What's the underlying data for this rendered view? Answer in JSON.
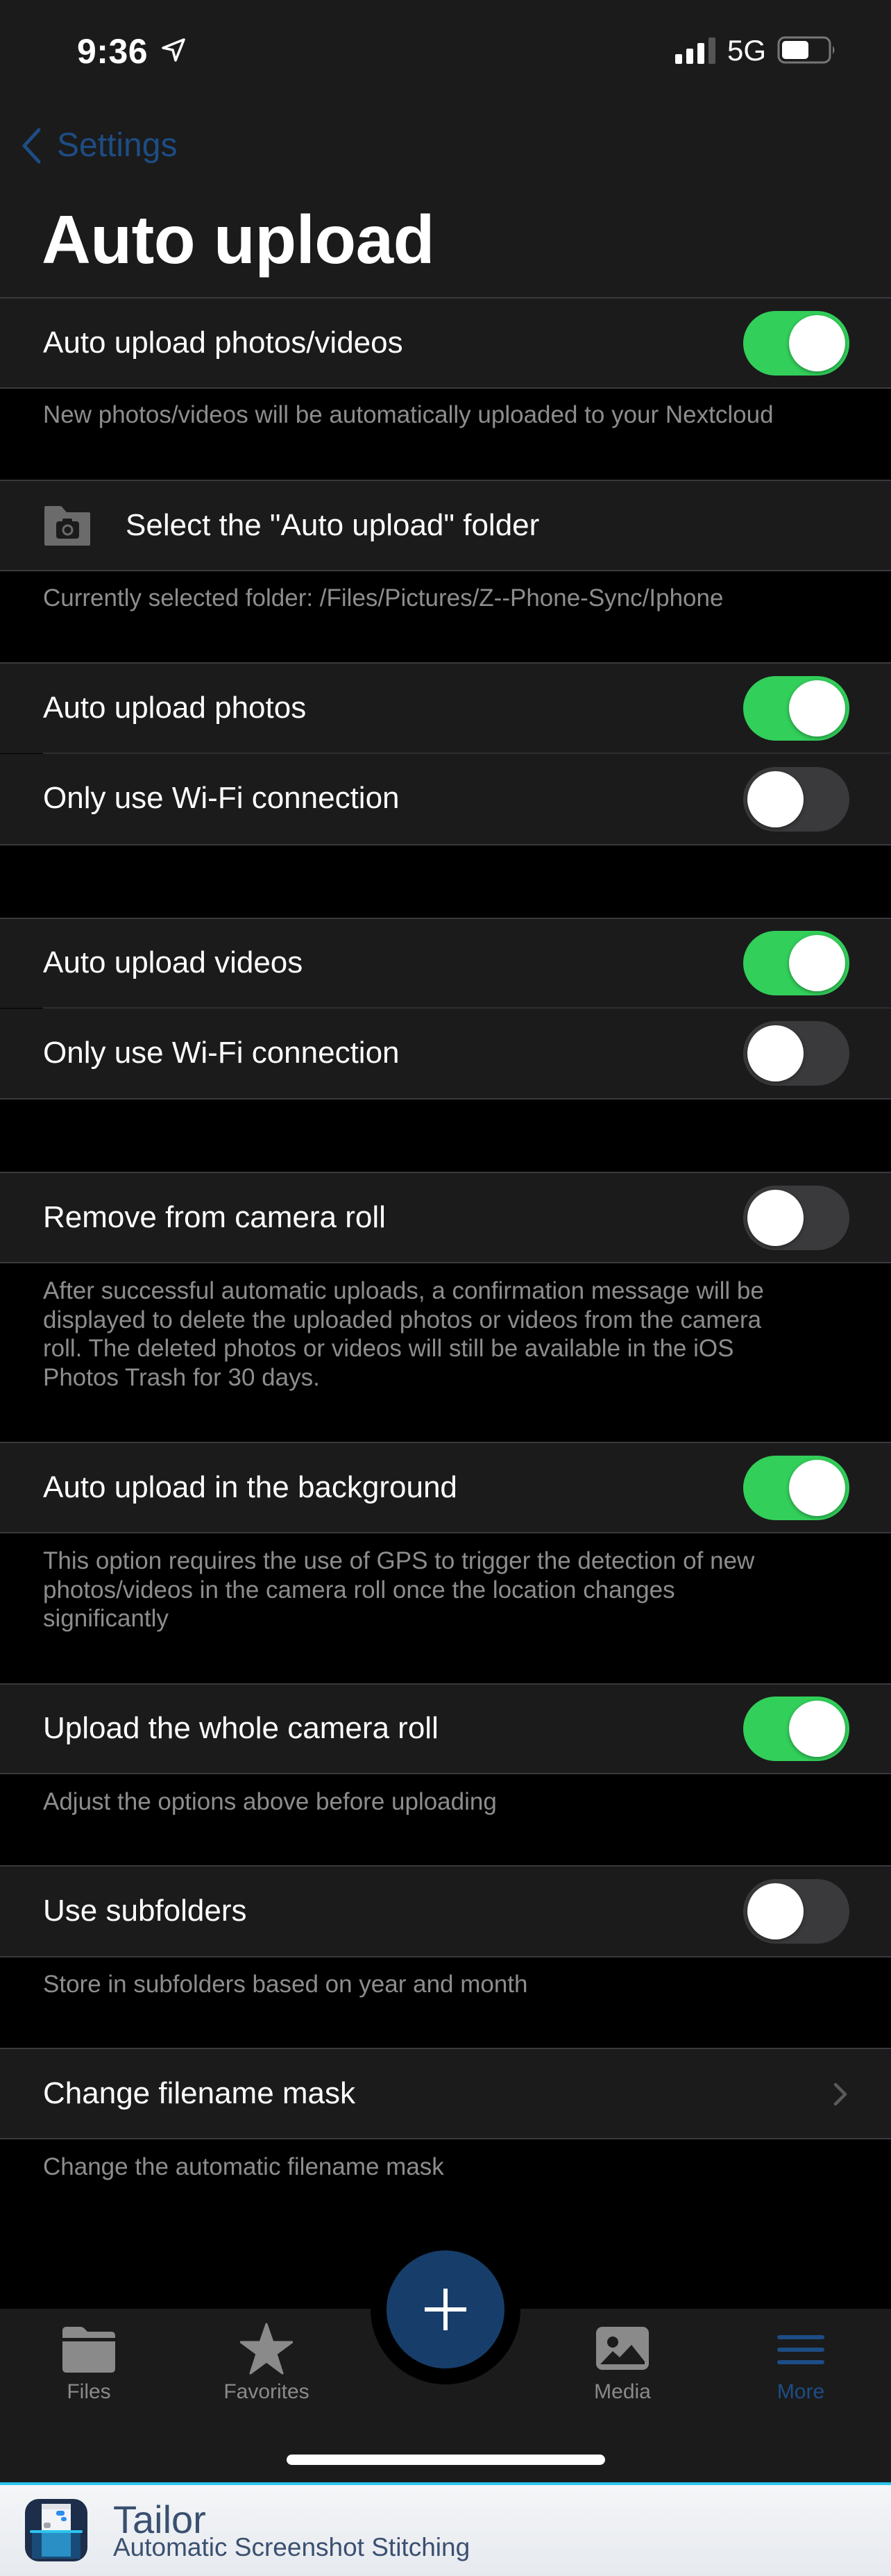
{
  "status_bar": {
    "time": "9:36",
    "network": "5G",
    "battery_percent": 55,
    "signal_bars": 3,
    "signal_bars_max": 4
  },
  "nav": {
    "back_label": "Settings",
    "title": "Auto upload"
  },
  "colors": {
    "accent": "#1d4d85",
    "toggle_on": "#32cf5a",
    "toggle_off": "#3a3a3c",
    "fab": "#173e6b",
    "banner_accent": "#2bc4ee"
  },
  "settings": {
    "auto_upload": {
      "label": "Auto upload photos/videos",
      "enabled": true,
      "footer": "New photos/videos will be automatically uploaded to your Nextcloud"
    },
    "folder": {
      "label": "Select the \"Auto upload\" folder",
      "icon": "folder-camera-icon",
      "footer": "Currently selected folder: /Files/Pictures/Z--Phone-Sync/Iphone"
    },
    "photos": {
      "label": "Auto upload photos",
      "enabled": true,
      "wifi_label": "Only use Wi-Fi connection",
      "wifi_only": false
    },
    "videos": {
      "label": "Auto upload videos",
      "enabled": true,
      "wifi_label": "Only use Wi-Fi connection",
      "wifi_only": false
    },
    "remove": {
      "label": "Remove from camera roll",
      "enabled": false,
      "footer_lines": [
        "After successful automatic uploads, a confirmation message will be",
        "displayed to delete the uploaded photos or videos from the camera",
        "roll. The deleted photos or videos will still be available in the iOS",
        "Photos Trash for 30 days."
      ]
    },
    "background": {
      "label": "Auto upload in the background",
      "enabled": true,
      "footer_lines": [
        "This option requires the use of GPS to trigger the detection of new",
        "photos/videos in the camera roll once the location changes",
        "significantly"
      ]
    },
    "whole_roll": {
      "label": "Upload the whole camera roll",
      "enabled": true,
      "footer": "Adjust the options above before uploading"
    },
    "subfolders": {
      "label": "Use subfolders",
      "enabled": false,
      "footer": "Store in subfolders based on year and month"
    },
    "filename_mask": {
      "label": "Change filename mask",
      "footer": "Change the automatic filename mask"
    }
  },
  "tabbar": {
    "tabs": [
      {
        "label": "Files",
        "icon": "folder-icon",
        "active": false
      },
      {
        "label": "Favorites",
        "icon": "star-icon",
        "active": false
      },
      {
        "label": "Media",
        "icon": "photo-icon",
        "active": false
      },
      {
        "label": "More",
        "icon": "menu-icon",
        "active": true
      }
    ],
    "fab_icon": "plus-icon"
  },
  "banner": {
    "title": "Tailor",
    "subtitle": "Automatic Screenshot Stitching"
  }
}
